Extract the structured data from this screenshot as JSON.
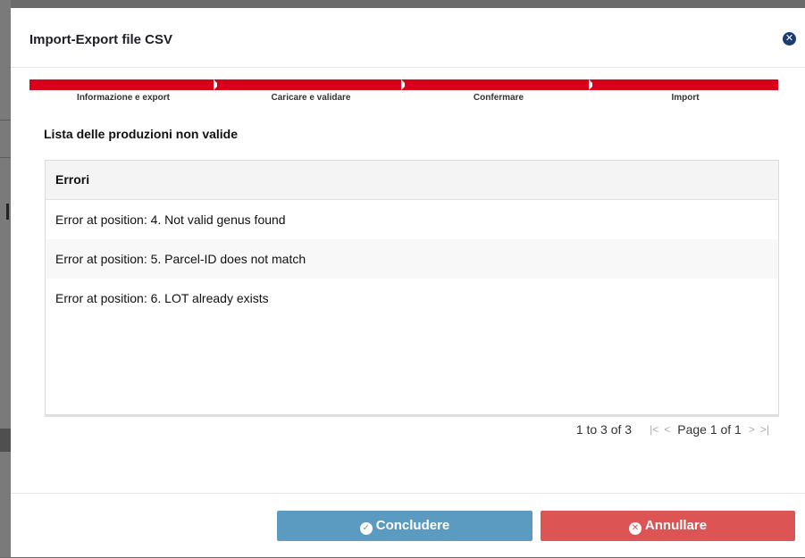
{
  "modal": {
    "title": "Import-Export file CSV",
    "close_icon": "close-circle-icon"
  },
  "steps": [
    {
      "label": "Informazione e export"
    },
    {
      "label": "Caricare e validare"
    },
    {
      "label": "Confermare"
    },
    {
      "label": "Import"
    }
  ],
  "section_title": "Lista delle produzioni non valide",
  "grid": {
    "header": "Errori",
    "rows": [
      "Error at position: 4. Not valid genus found",
      "Error at position: 5. Parcel-ID does not match",
      "Error at position: 6. LOT already exists"
    ]
  },
  "pager": {
    "summary": "1 to 3 of 3",
    "page_text": "Page 1 of 1",
    "first": "|<",
    "prev": "<",
    "next": ">",
    "last": ">|"
  },
  "buttons": {
    "confirm_label": "Concludere",
    "cancel_label": "Annullare",
    "confirm_icon": "check-circle-icon",
    "cancel_icon": "x-circle-icon"
  },
  "colors": {
    "step_red": "#d9001b",
    "confirm_blue": "#5b9bc1",
    "cancel_red": "#dd5454",
    "close_navy": "#1d3c6e"
  }
}
